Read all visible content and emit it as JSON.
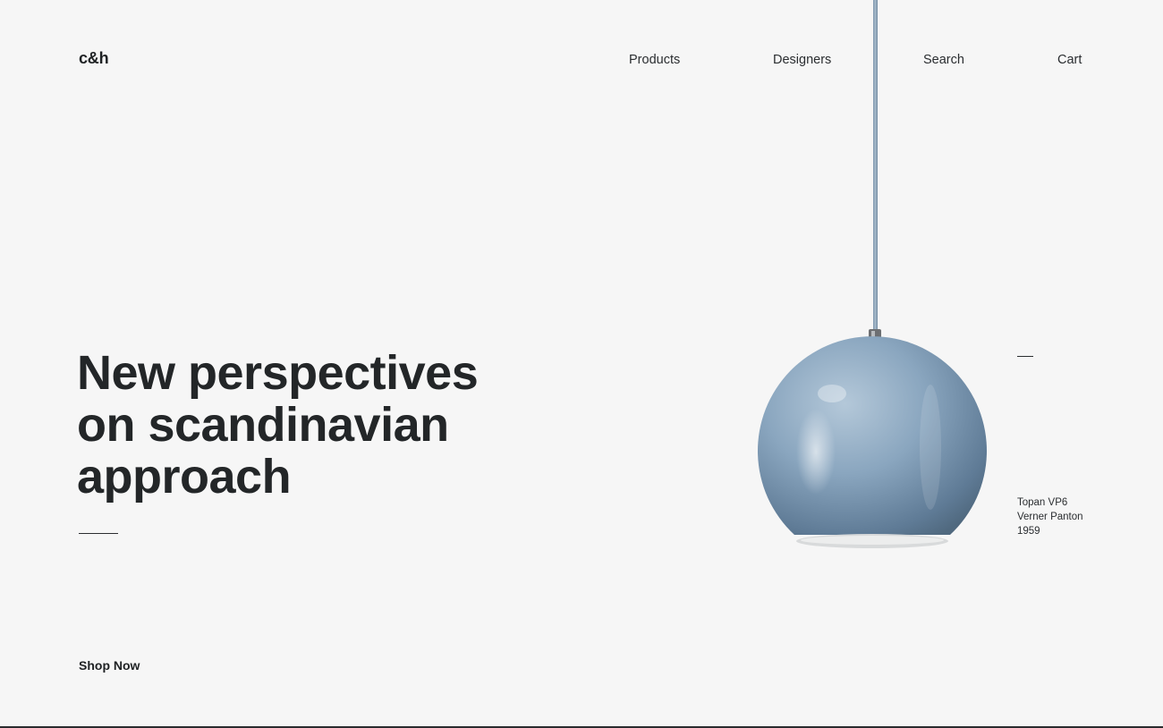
{
  "brand": {
    "logo": "c&h"
  },
  "nav": {
    "products": "Products",
    "designers": "Designers",
    "search": "Search",
    "cart": "Cart"
  },
  "hero": {
    "title_lines": [
      "New perspectives",
      "on scandinavian",
      "approach"
    ],
    "cta": "Shop Now"
  },
  "product": {
    "name": "Topan VP6",
    "designer": "Verner Panton",
    "year": "1959",
    "color": "#7f9cb6"
  },
  "colors": {
    "background": "#f6f6f6",
    "text": "#232628"
  }
}
